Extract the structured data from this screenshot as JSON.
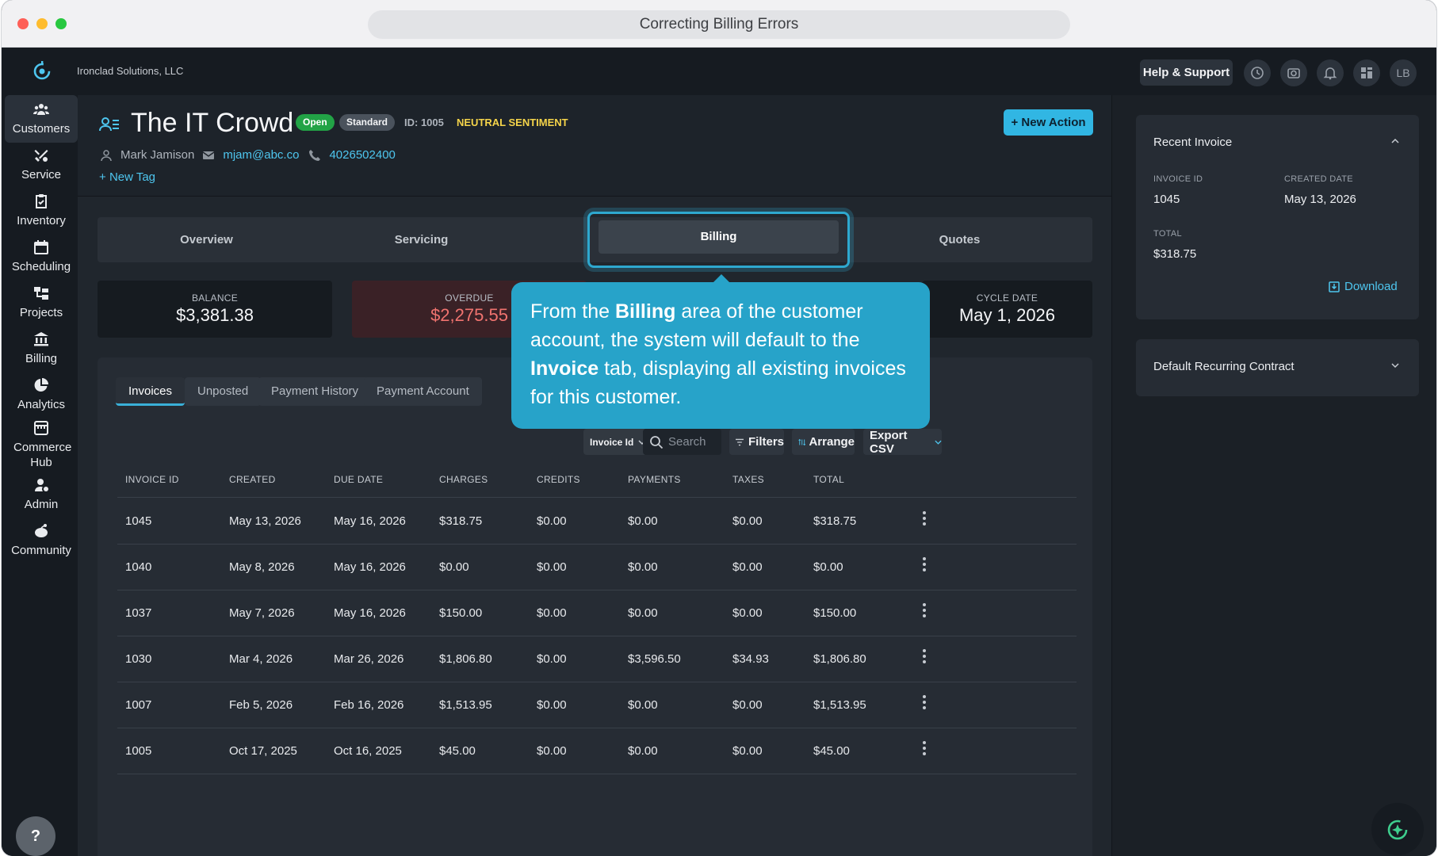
{
  "window": {
    "title": "Correcting Billing Errors"
  },
  "topbar": {
    "org": "Ironclad Solutions, LLC",
    "help_label": "Help & Support",
    "avatar": "LB"
  },
  "sidebar": {
    "items": [
      {
        "label": "Customers",
        "icon": "customers-icon"
      },
      {
        "label": "Service",
        "icon": "service-icon"
      },
      {
        "label": "Inventory",
        "icon": "inventory-icon"
      },
      {
        "label": "Scheduling",
        "icon": "calendar-icon"
      },
      {
        "label": "Projects",
        "icon": "projects-icon"
      },
      {
        "label": "Billing",
        "icon": "bank-icon"
      },
      {
        "label": "Analytics",
        "icon": "pie-chart-icon"
      },
      {
        "label": "Commerce Hub",
        "icon": "store-icon"
      },
      {
        "label": "Admin",
        "icon": "admin-icon"
      },
      {
        "label": "Community",
        "icon": "community-icon"
      }
    ],
    "help": "?"
  },
  "customer": {
    "name": "The IT Crowd",
    "status": "Open",
    "tier": "Standard",
    "id_text": "ID: 1005",
    "sentiment": "NEUTRAL SENTIMENT",
    "contact_name": "Mark Jamison",
    "email": "mjam@abc.co",
    "phone": "4026502400",
    "new_tag": "New Tag",
    "new_action": "New Action"
  },
  "tabs": {
    "overview": "Overview",
    "servicing": "Servicing",
    "billing": "Billing",
    "quotes": "Quotes"
  },
  "stats": {
    "balance_label": "BALANCE",
    "balance": "$3,381.38",
    "overdue_label": "OVERDUE",
    "overdue": "$2,275.55",
    "cycle_label": "CYCLE DATE",
    "cycle": "May 1, 2026"
  },
  "subtabs": {
    "invoices": "Invoices",
    "unposted": "Unposted",
    "payment_history": "Payment History",
    "payment_accounts": "Payment Account"
  },
  "controls": {
    "field_select": "Invoice Id",
    "search_placeholder": "Search",
    "filters": "Filters",
    "arrange": "Arrange",
    "export": "Export CSV"
  },
  "table": {
    "headers": {
      "invoice_id": "INVOICE ID",
      "created": "CREATED",
      "due": "DUE DATE",
      "charges": "CHARGES",
      "credits": "CREDITS",
      "payments": "PAYMENTS",
      "taxes": "TAXES",
      "total": "TOTAL"
    },
    "rows": [
      {
        "id": "1045",
        "created": "May 13, 2026",
        "due": "May 16, 2026",
        "charges": "$318.75",
        "credits": "$0.00",
        "payments": "$0.00",
        "taxes": "$0.00",
        "total": "$318.75"
      },
      {
        "id": "1040",
        "created": "May 8, 2026",
        "due": "May 16, 2026",
        "charges": "$0.00",
        "credits": "$0.00",
        "payments": "$0.00",
        "taxes": "$0.00",
        "total": "$0.00"
      },
      {
        "id": "1037",
        "created": "May 7, 2026",
        "due": "May 16, 2026",
        "charges": "$150.00",
        "credits": "$0.00",
        "payments": "$0.00",
        "taxes": "$0.00",
        "total": "$150.00"
      },
      {
        "id": "1030",
        "created": "Mar 4, 2026",
        "due": "Mar 26, 2026",
        "charges": "$1,806.80",
        "credits": "$0.00",
        "payments": "$3,596.50",
        "taxes": "$34.93",
        "total": "$1,806.80"
      },
      {
        "id": "1007",
        "created": "Feb 5, 2026",
        "due": "Feb 16, 2026",
        "charges": "$1,513.95",
        "credits": "$0.00",
        "payments": "$0.00",
        "taxes": "$0.00",
        "total": "$1,513.95"
      },
      {
        "id": "1005",
        "created": "Oct 17, 2025",
        "due": "Oct 16, 2025",
        "charges": "$45.00",
        "credits": "$0.00",
        "payments": "$0.00",
        "taxes": "$0.00",
        "total": "$45.00"
      }
    ]
  },
  "recent_invoice": {
    "title": "Recent Invoice",
    "id_label": "INVOICE ID",
    "id": "1045",
    "created_label": "CREATED DATE",
    "created": "May 13, 2026",
    "total_label": "TOTAL",
    "total": "$318.75",
    "download": "Download"
  },
  "contract": {
    "title": "Default Recurring Contract"
  },
  "tooltip": {
    "p1": "From the ",
    "b1": "Billing",
    "p2": " area of the customer account, the system will default to the ",
    "b2": "Invoice",
    "p3": " tab, displaying all existing invoices for this customer."
  }
}
